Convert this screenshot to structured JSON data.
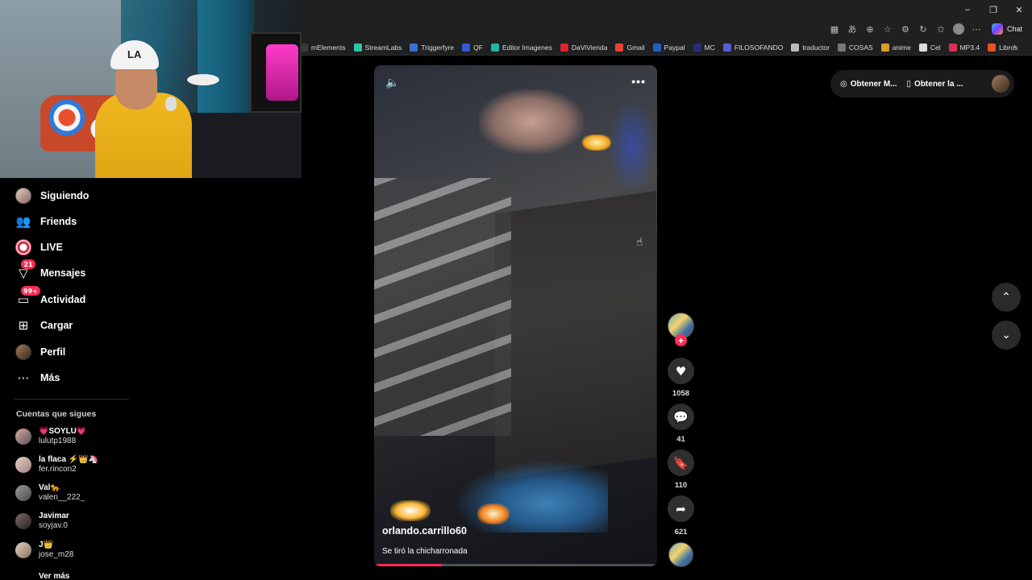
{
  "browser": {
    "window_controls": {
      "minimize": "–",
      "restore": "❐",
      "close": "✕"
    },
    "toolbar_icons": [
      "grid-icon",
      "translate-icon",
      "zoom-icon",
      "star-icon",
      "extensions-icon",
      "refresh-icon",
      "favorites-icon",
      "profile-icon",
      "more-icon"
    ],
    "chat_label": "Chat",
    "bookmarks": [
      {
        "label": "mElements",
        "color": "#3a3a3a"
      },
      {
        "label": "StreamLabs",
        "color": "#31c3a2"
      },
      {
        "label": "Triggerfyre",
        "color": "#3b6fd8"
      },
      {
        "label": "QF",
        "color": "#3857d4"
      },
      {
        "label": "Editor Imagenes",
        "color": "#1fb6a6"
      },
      {
        "label": "DaViVienda",
        "color": "#d8262f"
      },
      {
        "label": "Gmail",
        "color": "#ea4335"
      },
      {
        "label": "Paypal",
        "color": "#1f5fbf"
      },
      {
        "label": "MC",
        "color": "#2a2a7a"
      },
      {
        "label": "FILOSOFANDO",
        "color": "#5a5ad8"
      },
      {
        "label": "traductor",
        "color": "#bbbbbb"
      },
      {
        "label": "COSAS",
        "color": "#777777"
      },
      {
        "label": "anime",
        "color": "#d8a030"
      },
      {
        "label": "Cel",
        "color": "#dddddd"
      },
      {
        "label": "MP3.4",
        "color": "#d83050"
      },
      {
        "label": "Libros",
        "color": "#e8531f"
      }
    ]
  },
  "sidebar": {
    "nav": [
      {
        "label": "Siguiendo",
        "icon": "following-avatar-icon"
      },
      {
        "label": "Friends",
        "icon": "friends-icon"
      },
      {
        "label": "LIVE",
        "icon": "live-icon"
      },
      {
        "label": "Mensajes",
        "icon": "messages-icon",
        "badge": "21"
      },
      {
        "label": "Actividad",
        "icon": "activity-icon",
        "badge": "99+"
      },
      {
        "label": "Cargar",
        "icon": "upload-icon"
      },
      {
        "label": "Perfil",
        "icon": "profile-icon"
      },
      {
        "label": "Más",
        "icon": "more-icon"
      }
    ],
    "following_title": "Cuentas que sigues",
    "following": [
      {
        "name": "💗SOYLU💗",
        "username": "lulutp1988"
      },
      {
        "name": "la flaca ⚡👑🦄",
        "username": "fer.rincon2"
      },
      {
        "name": "Val🐆",
        "username": "valen__222_"
      },
      {
        "name": "Javimar",
        "username": "soyjav.0"
      },
      {
        "name": "J👑",
        "username": "jose_m28"
      }
    ],
    "see_more": "Ver más"
  },
  "video": {
    "author": "orlando.carrillo60",
    "caption": "Se tiró la chicharronada",
    "progress": 0.24
  },
  "actions": {
    "likes": "1058",
    "comments": "41",
    "saves": "110",
    "shares": "621"
  },
  "top_right": {
    "get_app_1": "Obtener M...",
    "get_app_2": "Obtener la ..."
  },
  "colors": {
    "accent": "#fe2c55",
    "background": "#000000"
  }
}
